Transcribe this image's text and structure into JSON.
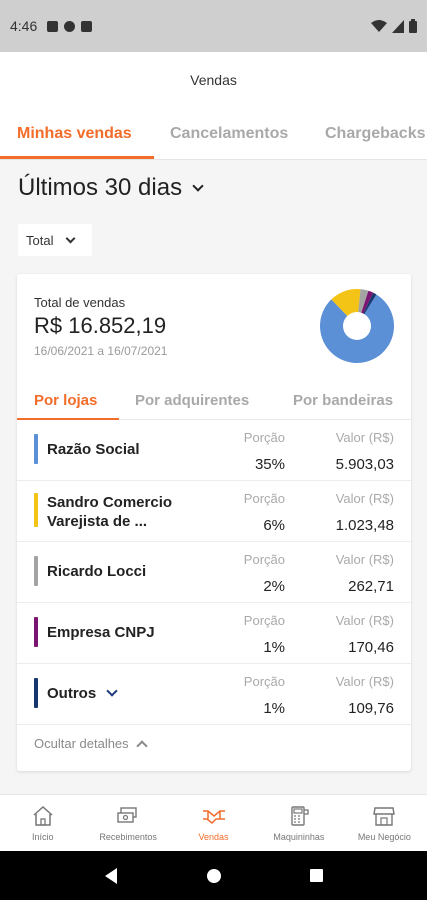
{
  "status": {
    "time": "4:46"
  },
  "header": {
    "title": "Vendas"
  },
  "tabs": [
    {
      "label": "Minhas vendas",
      "active": true
    },
    {
      "label": "Cancelamentos",
      "active": false
    },
    {
      "label": "Chargebacks",
      "active": false
    }
  ],
  "period": {
    "label": "Últimos 30 dias"
  },
  "filter": {
    "selected": "Total"
  },
  "summary": {
    "total_label": "Total de vendas",
    "total_value": "R$ 16.852,19",
    "date_range": "16/06/2021 a 16/07/2021"
  },
  "subtabs": [
    {
      "label": "Por lojas",
      "active": true
    },
    {
      "label": "Por adquirentes",
      "active": false
    },
    {
      "label": "Por bandeiras",
      "active": false
    }
  ],
  "rows": [
    {
      "name_line1": "Razão Social",
      "name_line2": "",
      "portion_label": "Porção",
      "portion": "35%",
      "value_label": "Valor (R$)",
      "value": "5.903,03",
      "color": "#5b8fd6"
    },
    {
      "name_line1": "Sandro Comercio",
      "name_line2": "Varejista de ...",
      "portion_label": "Porção",
      "portion": "6%",
      "value_label": "Valor (R$)",
      "value": "1.023,48",
      "color": "#f3c316"
    },
    {
      "name_line1": "Ricardo Locci",
      "name_line2": "",
      "portion_label": "Porção",
      "portion": "2%",
      "value_label": "Valor (R$)",
      "value": "262,71",
      "color": "#a3a3a3"
    },
    {
      "name_line1": "Empresa CNPJ",
      "name_line2": "",
      "portion_label": "Porção",
      "portion": "1%",
      "value_label": "Valor (R$)",
      "value": "170,46",
      "color": "#7b1572"
    },
    {
      "name_line1": "Outros",
      "name_line2": "",
      "portion_label": "Porção",
      "portion": "1%",
      "value_label": "Valor (R$)",
      "value": "109,76",
      "color": "#17366e"
    }
  ],
  "hide_details": "Ocultar detalhes",
  "bottom_nav": [
    {
      "label": "Início",
      "icon": "home-icon",
      "active": false
    },
    {
      "label": "Recebimentos",
      "icon": "money-icon",
      "active": false
    },
    {
      "label": "Vendas",
      "icon": "handshake-icon",
      "active": true
    },
    {
      "label": "Maquininhas",
      "icon": "card-machine-icon",
      "active": false
    },
    {
      "label": "Meu Negócio",
      "icon": "store-icon",
      "active": false
    }
  ],
  "colors": {
    "accent": "#f26c2a",
    "inactive": "#a9a9a9"
  }
}
